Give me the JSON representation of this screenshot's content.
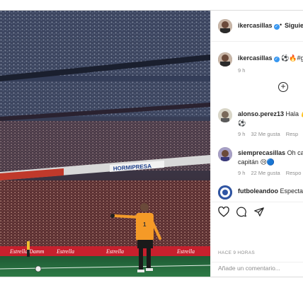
{
  "post": {
    "username": "ikercasillas",
    "follow_label": "Siguien",
    "caption_emoji": "⚽️🔥#g",
    "caption_time": "9 h",
    "stadium_sign": "HORMIPRESA",
    "sponsor": "Estrella Damm",
    "jersey_number": "1"
  },
  "comments": [
    {
      "username": "alonso.perez13",
      "text": "Hala 💪",
      "line2": "⚽️",
      "time": "9 h",
      "likes": "32 Me gusta",
      "reply": "Resp"
    },
    {
      "username": "siemprecasillas",
      "text": "Oh cap",
      "line2": "capitán 😢🔵",
      "time": "9 h",
      "likes": "22 Me gusta",
      "reply": "Respo"
    },
    {
      "username": "futboleandoo",
      "text": "Espectac",
      "line2": "",
      "time": "",
      "likes": "",
      "reply": ""
    }
  ],
  "actions": {
    "like_icon": "heart-icon",
    "comment_icon": "comment-bubble-icon",
    "share_icon": "send-icon"
  },
  "footer": {
    "time_ago": "HACE 9 HORAS",
    "comment_placeholder": "Añade un comentario..."
  }
}
